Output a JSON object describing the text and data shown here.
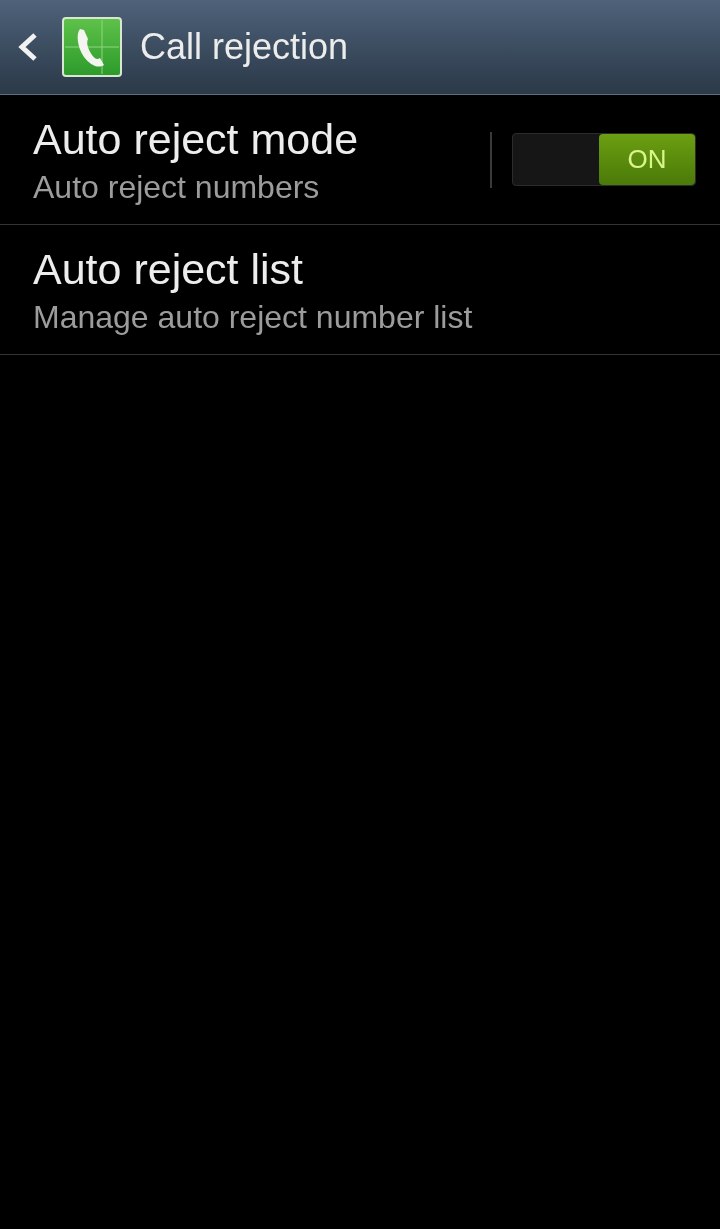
{
  "action_bar": {
    "title": "Call rejection"
  },
  "items": [
    {
      "kind": "switch",
      "title": "Auto reject mode",
      "subtitle": "Auto reject numbers",
      "on": true,
      "switch_label": "ON"
    },
    {
      "kind": "plain",
      "title": "Auto reject list",
      "subtitle": "Manage auto reject number list"
    }
  ]
}
